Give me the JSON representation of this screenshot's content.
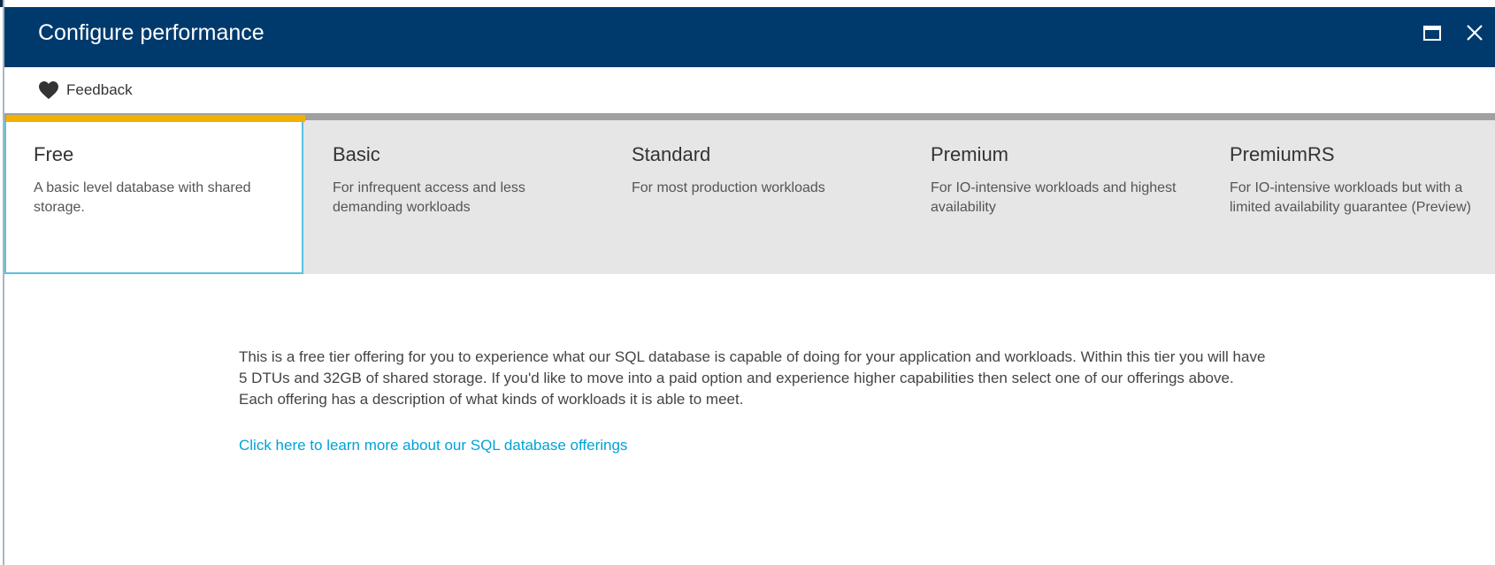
{
  "blade": {
    "title": "Configure performance",
    "maximize_icon": "maximize-icon",
    "close_icon": "close-icon"
  },
  "command_bar": {
    "feedback_label": "Feedback",
    "feedback_icon": "heart-icon"
  },
  "tiers": [
    {
      "name": "Free",
      "description": "A basic level database with shared storage.",
      "selected": true
    },
    {
      "name": "Basic",
      "description": "For infrequent access and less demanding workloads",
      "selected": false
    },
    {
      "name": "Standard",
      "description": "For most production workloads",
      "selected": false
    },
    {
      "name": "Premium",
      "description": "For IO-intensive workloads and highest availability",
      "selected": false
    },
    {
      "name": "PremiumRS",
      "description": "For IO-intensive workloads but with a limited availability guarantee (Preview)",
      "selected": false
    }
  ],
  "content": {
    "description": "This is a free tier offering for you to experience what our SQL database is capable of doing for your application and workloads. Within this tier you will have 5 DTUs and 32GB of shared storage. If you'd like to move into a paid option and experience higher capabilities then select one of our offerings above. Each offering has a description of what kinds of workloads it is able to meet.",
    "learn_more_link": "Click here to learn more about our SQL database offerings"
  },
  "colors": {
    "header_bg": "#003a6d",
    "selected_accent": "#f2b000",
    "selected_border": "#5bc0de",
    "link": "#00a2d8",
    "tiers_bg": "#e6e6e6"
  }
}
